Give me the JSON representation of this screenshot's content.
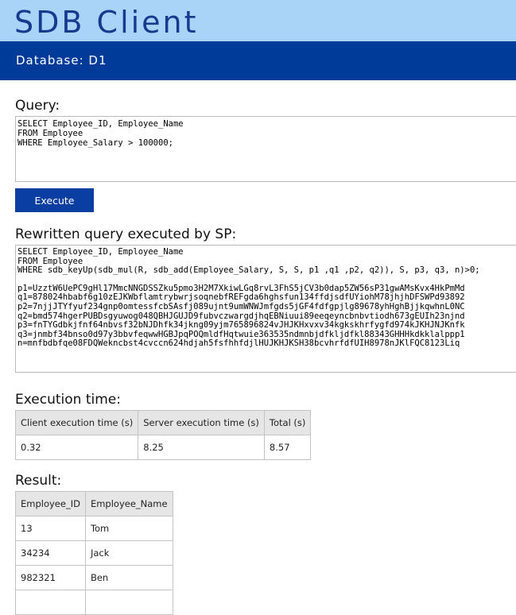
{
  "app": {
    "title": "SDB Client",
    "database_label": "Database: D1"
  },
  "query": {
    "heading": "Query:",
    "lines": [
      "SELECT Employee_ID, Employee_Name",
      "FROM Employee",
      "WHERE Employee_Salary > 100000;"
    ]
  },
  "execute_button": {
    "label": "Execute"
  },
  "rewritten": {
    "heading": "Rewritten query executed by SP:",
    "query_lines": [
      "SELECT Employee_ID, Employee_Name",
      "FROM Employee",
      "WHERE sdb_keyUp(sdb_mul(R, sdb_add(Employee_Salary, S, S, p1 ,q1 ,p2, q2)), S, p3, q3, n)>0;"
    ],
    "param_lines": [
      "p1=UzztW6UePC9gHl17MmcNNGDSSZku5pmo3H2M7XkiwLGq8rvL3FhS5jCV3b0dap5ZW56sP31gwAMsKvx4HkPmMd",
      "q1=878024hbabf6g10zEJKWbflamtrybwrjsoqnebfREFgda6hghsfun134ffdjsdfUYiohM78jhjhDFSWPd93892",
      "p2=7njjJTYfyuf234gnp0omtessfcbSAsfj089ujnt9umWNWJmfgds5jGF4fdfgpjlg89678yhHghBjjkqwhnL0NC",
      "q2=bmd574hgerPUBDsgyuwog048QBHJGUJD9fubvczwargdjhqEBNiuui89eeqeyncbnbvtiodh673gEUIh23njnd",
      "p3=fnTYGdbkjfnf64nbvsf32bNJDhfk34jkng09yjm765896824vJHJKHxvxv34kgkskhrfygfd974kJKHJNJKnfk",
      "q3=jnmbf34bnso0d97y3bbvfeqwwHGBJpqPOQmldfHqtwuie363535ndmnbjdfkljdfkl88343GHHHkdkklalppp1",
      "n=mnfbdbfqe08FDQWekncbst4cvccn624hdjah5fsfhhfdjlHUJKHJKSH38bcvhrfdfUIH8978nJKlFQC8123Liq"
    ]
  },
  "execution_time": {
    "heading": "Execution time:",
    "columns": [
      "Client execution time (s)",
      "Server execution time (s)",
      "Total (s)"
    ],
    "values": [
      "0.32",
      "8.25",
      "8.57"
    ]
  },
  "result": {
    "heading": "Result:",
    "columns": [
      "Employee_ID",
      "Employee_Name"
    ],
    "rows": [
      [
        "13",
        "Tom"
      ],
      [
        "34234",
        "Jack"
      ],
      [
        "982321",
        "Ben"
      ],
      [
        "",
        ""
      ]
    ]
  },
  "colors": {
    "header_light": "#a9d4f8",
    "header_dark": "#003b99",
    "title_text": "#173a8f",
    "button": "#0a3ea0",
    "table_header_bg": "#e6e6e6"
  }
}
